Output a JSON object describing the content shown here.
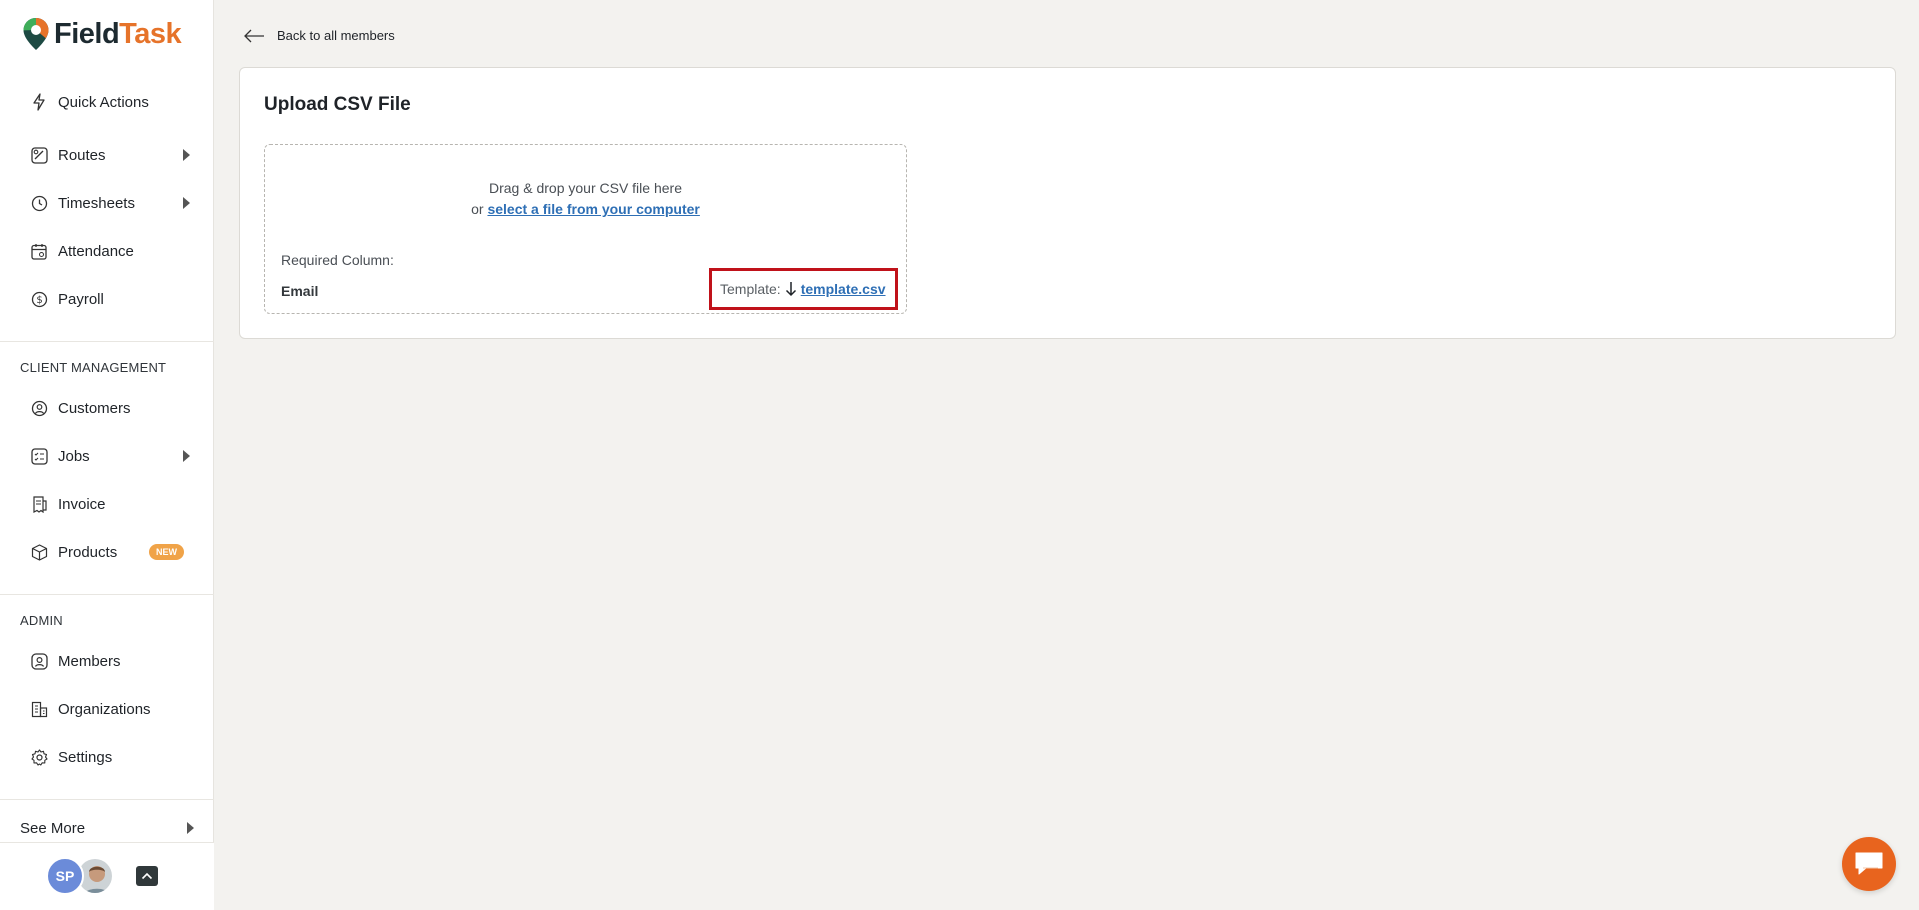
{
  "brand": {
    "part1": "Field",
    "part2": "Task",
    "accent": "#e6732a"
  },
  "sidebar": {
    "items": [
      {
        "label": "Quick Actions",
        "icon": "lightning-icon"
      },
      {
        "label": "Routes",
        "icon": "route-icon",
        "expandable": true
      },
      {
        "label": "Timesheets",
        "icon": "clock-icon",
        "expandable": true
      },
      {
        "label": "Attendance",
        "icon": "calendar-icon"
      },
      {
        "label": "Payroll",
        "icon": "payroll-icon"
      }
    ],
    "client_section": "CLIENT MANAGEMENT",
    "client_items": [
      {
        "label": "Customers",
        "icon": "customer-icon"
      },
      {
        "label": "Jobs",
        "icon": "jobs-icon",
        "expandable": true
      },
      {
        "label": "Invoice",
        "icon": "invoice-icon"
      },
      {
        "label": "Products",
        "icon": "box-icon",
        "badge": "NEW"
      }
    ],
    "admin_section": "ADMIN",
    "admin_items": [
      {
        "label": "Members",
        "icon": "member-icon"
      },
      {
        "label": "Organizations",
        "icon": "organization-icon"
      },
      {
        "label": "Settings",
        "icon": "gear-icon"
      }
    ],
    "see_more": "See More",
    "user_initials": "SP"
  },
  "main": {
    "back_label": "Back to all members",
    "card_title": "Upload CSV File",
    "dropzone": {
      "line1": "Drag & drop your CSV file here",
      "line2_prefix": "or",
      "line2_link": "select a file from your computer",
      "required_label": "Required Column:",
      "required_value": "Email",
      "template_label": "Template:",
      "template_link": "template.csv"
    }
  }
}
